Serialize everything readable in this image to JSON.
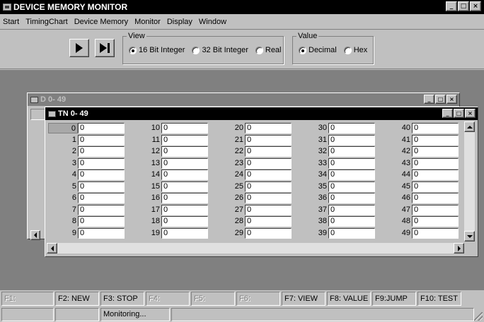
{
  "window": {
    "title": "DEVICE MEMORY MONITOR",
    "controls": [
      "_",
      "□",
      "×"
    ]
  },
  "menu": [
    "Start",
    "TimingChart",
    "Device Memory",
    "Monitor",
    "Display",
    "Window"
  ],
  "toolbar": {
    "view": {
      "label": "View",
      "options": [
        "16 Bit Integer",
        "32 Bit Integer",
        "Real"
      ],
      "selected": "16 Bit Integer"
    },
    "value": {
      "label": "Value",
      "options": [
        "Decimal",
        "Hex"
      ],
      "selected": "Decimal"
    }
  },
  "back_window": {
    "title": "D  0- 49"
  },
  "front_window": {
    "title": "TN 0- 49",
    "columns": [
      {
        "indices": [
          "0",
          "1",
          "2",
          "3",
          "4",
          "5",
          "6",
          "7",
          "8",
          "9"
        ],
        "values": [
          "0",
          "0",
          "0",
          "0",
          "0",
          "0",
          "0",
          "0",
          "0",
          "0"
        ]
      },
      {
        "indices": [
          "10",
          "11",
          "12",
          "13",
          "14",
          "15",
          "16",
          "17",
          "18",
          "19"
        ],
        "values": [
          "0",
          "0",
          "0",
          "0",
          "0",
          "0",
          "0",
          "0",
          "0",
          "0"
        ]
      },
      {
        "indices": [
          "20",
          "21",
          "22",
          "23",
          "24",
          "25",
          "26",
          "27",
          "28",
          "29"
        ],
        "values": [
          "0",
          "0",
          "0",
          "0",
          "0",
          "0",
          "0",
          "0",
          "0",
          "0"
        ]
      },
      {
        "indices": [
          "30",
          "31",
          "32",
          "33",
          "34",
          "35",
          "36",
          "37",
          "38",
          "39"
        ],
        "values": [
          "0",
          "0",
          "0",
          "0",
          "0",
          "0",
          "0",
          "0",
          "0",
          "0"
        ]
      },
      {
        "indices": [
          "40",
          "41",
          "42",
          "43",
          "44",
          "45",
          "46",
          "47",
          "48",
          "49"
        ],
        "values": [
          "0",
          "0",
          "0",
          "0",
          "0",
          "0",
          "0",
          "0",
          "0",
          "0"
        ]
      }
    ]
  },
  "function_keys": [
    {
      "label": "F1:",
      "enabled": false
    },
    {
      "label": "F2: NEW",
      "enabled": true
    },
    {
      "label": "F3: STOP",
      "enabled": true
    },
    {
      "label": "F4:",
      "enabled": false
    },
    {
      "label": "F5:",
      "enabled": false
    },
    {
      "label": "F6:",
      "enabled": false
    },
    {
      "label": "F7: VIEW",
      "enabled": true
    },
    {
      "label": "F8: VALUE",
      "enabled": true
    },
    {
      "label": "F9:JUMP",
      "enabled": true
    },
    {
      "label": "F10: TEST",
      "enabled": true
    }
  ],
  "status": {
    "message": "Monitoring..."
  }
}
